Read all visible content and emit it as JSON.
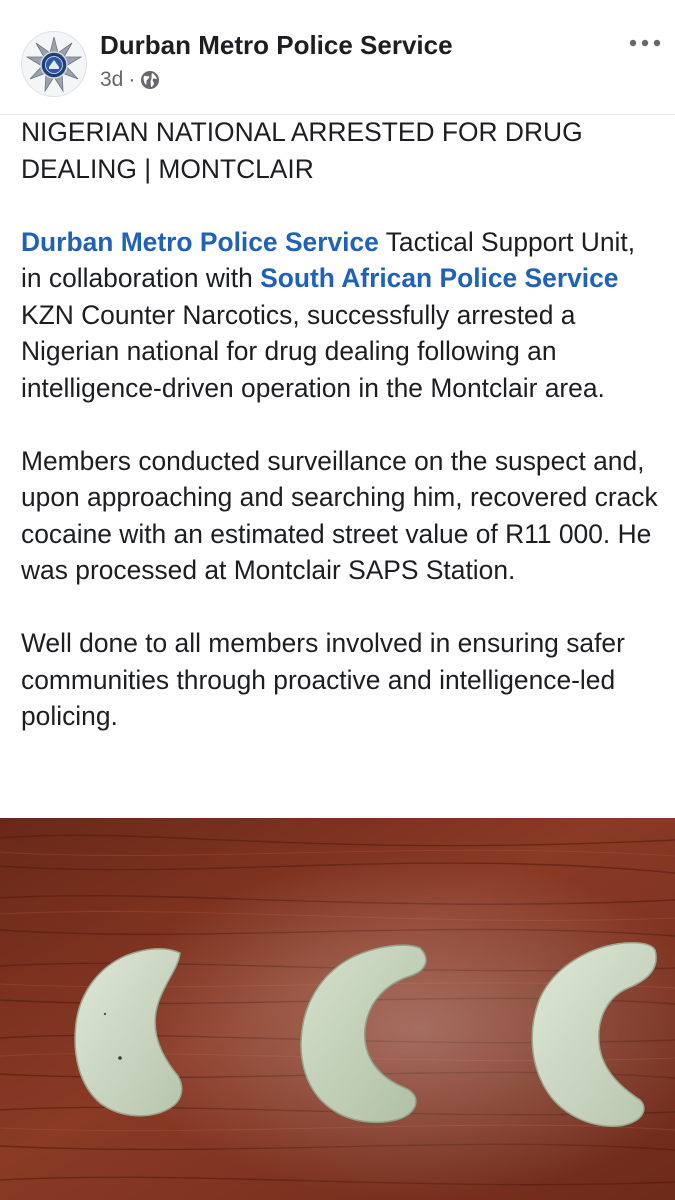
{
  "post": {
    "page_name": "Durban Metro Police Service",
    "timestamp": "3d",
    "separator": "·",
    "audience_icon": "globe-icon",
    "more_icon": "more-options-icon",
    "avatar_icon": "police-star-badge-icon",
    "headline_line1": "NIGERIAN NATIONAL ARRESTED FOR DRUG",
    "headline_line2": "DEALING | MONTCLAIR",
    "paragraph1": {
      "mention1": "Durban Metro Police Service",
      "text1": " Tactical Support Unit, in collaboration with ",
      "mention2": "South African Police Service",
      "text2": " KZN Counter Narcotics, successfully arrested a Nigerian national for drug dealing following an intelligence-driven operation in the Montclair area."
    },
    "paragraph2": "Members conducted surveillance on the suspect and, upon approaching and searching him, recovered crack cocaine with an estimated street value of R11 000. He was processed at Montclair SAPS Station.",
    "paragraph3": "Well done to all members involved in ensuring safer communities through proactive and intelligence-led policing."
  },
  "colors": {
    "link": "#1f62b8",
    "text": "#1c1e21",
    "meta": "#65676b",
    "photo_table": "#7a2f1e"
  }
}
